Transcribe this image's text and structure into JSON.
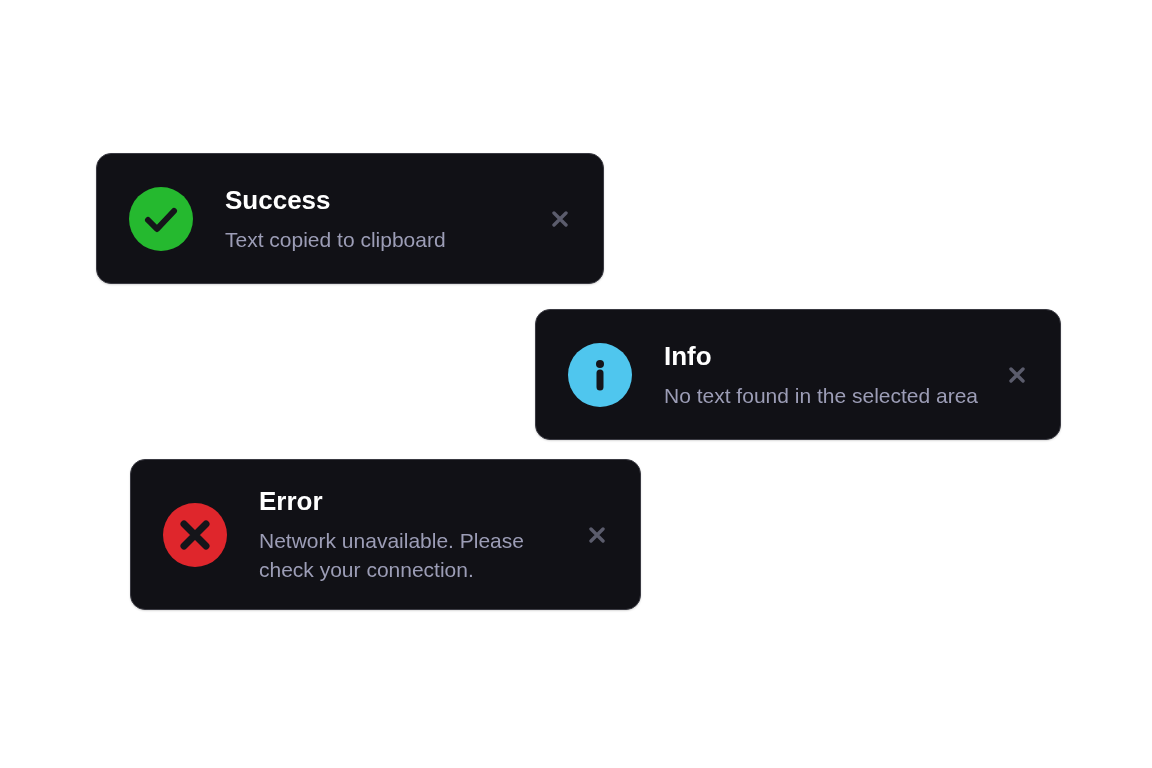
{
  "toasts": [
    {
      "kind": "success",
      "color": "#25b92f",
      "title": "Success",
      "message": "Text copied to clipboard"
    },
    {
      "kind": "info",
      "color": "#4fc6ee",
      "title": "Info",
      "message": "No text found in the selected area"
    },
    {
      "kind": "error",
      "color": "#df262c",
      "title": "Error",
      "message": "Network unavailable. Please check your connection."
    }
  ]
}
